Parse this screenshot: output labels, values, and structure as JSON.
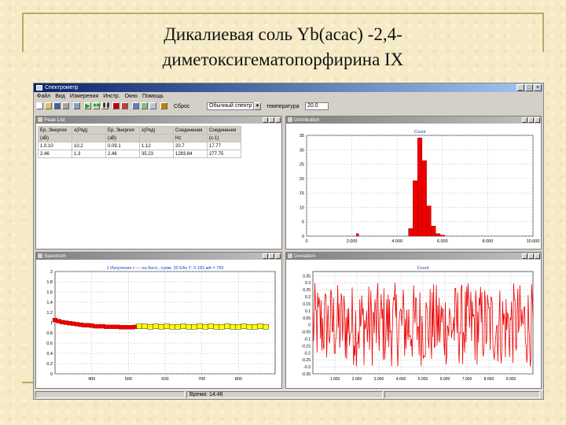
{
  "slide": {
    "title_line1": "Дикалиевая соль Yb(acac) -2,4-",
    "title_line2": "диметоксигематопорфирина  IX"
  },
  "app": {
    "title": "Спектрометр",
    "menu": [
      "Файл",
      "Вид",
      "Измерения",
      "Инстр.",
      "Окно",
      "Помощь"
    ],
    "toolbar": {
      "label1": "Сброс",
      "dropdown_value": "Обычный спектр",
      "label2": "температура",
      "temperature_value": "20.0"
    },
    "status": [
      "",
      "Время: 14:46",
      ""
    ]
  },
  "peak_list": {
    "title": "Peak List",
    "headers": [
      [
        "Ep, Энергия",
        "λ(Ряд)",
        "Ep, Энергия",
        "λ(Ряд)",
        "Соединения",
        "Соединения"
      ],
      [
        "(эВ)",
        "",
        "(эВ)",
        "",
        "Hz",
        "(с-1)"
      ]
    ],
    "rows": [
      [
        "1.0.10",
        "10.2",
        "0.09.1",
        "1.12",
        "20.7",
        "17.77"
      ],
      [
        "2.46",
        "1.3",
        "2.46",
        "35.23",
        "1283.84",
        "277.75"
      ]
    ]
  },
  "colors": {
    "series": "#ee0000",
    "highlight": "#ffff00"
  },
  "charts": {
    "distribution": {
      "title": "Distribution",
      "legend": "Count",
      "chart_data": {
        "type": "bar",
        "xlim": [
          0,
          10000
        ],
        "ylim": [
          0,
          40
        ],
        "xticks": [
          "0",
          "2.000",
          "4.000",
          "6.000",
          "8.000",
          "10.000"
        ],
        "yticks": [
          "0",
          "5",
          "10",
          "15",
          "20",
          "25",
          "30",
          "35"
        ],
        "grid": true,
        "bars": [
          {
            "x": 2200,
            "w": 100,
            "value": 1
          },
          {
            "x": 4500,
            "w": 200,
            "value": 3
          },
          {
            "x": 4700,
            "w": 200,
            "value": 22
          },
          {
            "x": 4900,
            "w": 200,
            "value": 39
          },
          {
            "x": 5100,
            "w": 200,
            "value": 30
          },
          {
            "x": 5300,
            "w": 200,
            "value": 12
          },
          {
            "x": 5500,
            "w": 200,
            "value": 4
          },
          {
            "x": 5700,
            "w": 200,
            "value": 1
          },
          {
            "x": 5900,
            "w": 200,
            "value": 0.4
          }
        ]
      }
    },
    "spectrum": {
      "title": "Spectrum",
      "legend": "1 Излучение  с  — на бисп., сумм. 20 ЕАх Т: 0.183 мА = 750",
      "chart_data": {
        "type": "line",
        "xlim": [
          300,
          900
        ],
        "ylim": [
          0,
          2.0
        ],
        "xticks": [
          "400",
          "500",
          "600",
          "700",
          "800"
        ],
        "yticks": [
          "0",
          "0.2",
          "0.4",
          "0.6",
          "0.8",
          "1",
          "1.2",
          "1.4",
          "1.6",
          "1.8",
          "2"
        ],
        "grid": true,
        "red_x": [
          300,
          310,
          320,
          330,
          340,
          350,
          360,
          370,
          380,
          390,
          400,
          410,
          420,
          430,
          440,
          450,
          460,
          470,
          480,
          490,
          500,
          510,
          520
        ],
        "red_y": [
          1.05,
          1.03,
          1.01,
          1.0,
          0.99,
          0.98,
          0.97,
          0.96,
          0.95,
          0.95,
          0.94,
          0.93,
          0.93,
          0.93,
          0.92,
          0.92,
          0.92,
          0.92,
          0.91,
          0.91,
          0.91,
          0.91,
          0.92
        ],
        "yellow_x": [
          530,
          545,
          560,
          575,
          590,
          605,
          620,
          635,
          650,
          665,
          680,
          695,
          710,
          725,
          740,
          755,
          770,
          785,
          800,
          815,
          830,
          845,
          860,
          875
        ],
        "yellow_y": [
          0.93,
          0.93,
          0.92,
          0.93,
          0.92,
          0.93,
          0.92,
          0.92,
          0.93,
          0.92,
          0.92,
          0.93,
          0.92,
          0.93,
          0.92,
          0.92,
          0.93,
          0.92,
          0.92,
          0.93,
          0.92,
          0.92,
          0.93,
          0.92
        ]
      }
    },
    "deviation": {
      "title": "Deviation",
      "legend": "Count",
      "chart_data": {
        "type": "line",
        "xlim": [
          0,
          10000
        ],
        "ylim": [
          -0.35,
          0.38
        ],
        "xticks": [
          "1.000",
          "2.000",
          "3.000",
          "4.000",
          "5.000",
          "6.000",
          "7.000",
          "8.000",
          "9.000"
        ],
        "yticks": [
          "-0.35",
          "-0.3",
          "-0.25",
          "-0.2",
          "-0.15",
          "-0.1",
          "-0.05",
          "0",
          "0.05",
          "0.1",
          "0.15",
          "0.2",
          "0.25",
          "0.3",
          "0.35"
        ],
        "grid": true,
        "points": 320,
        "amplitude": 0.3
      }
    }
  }
}
